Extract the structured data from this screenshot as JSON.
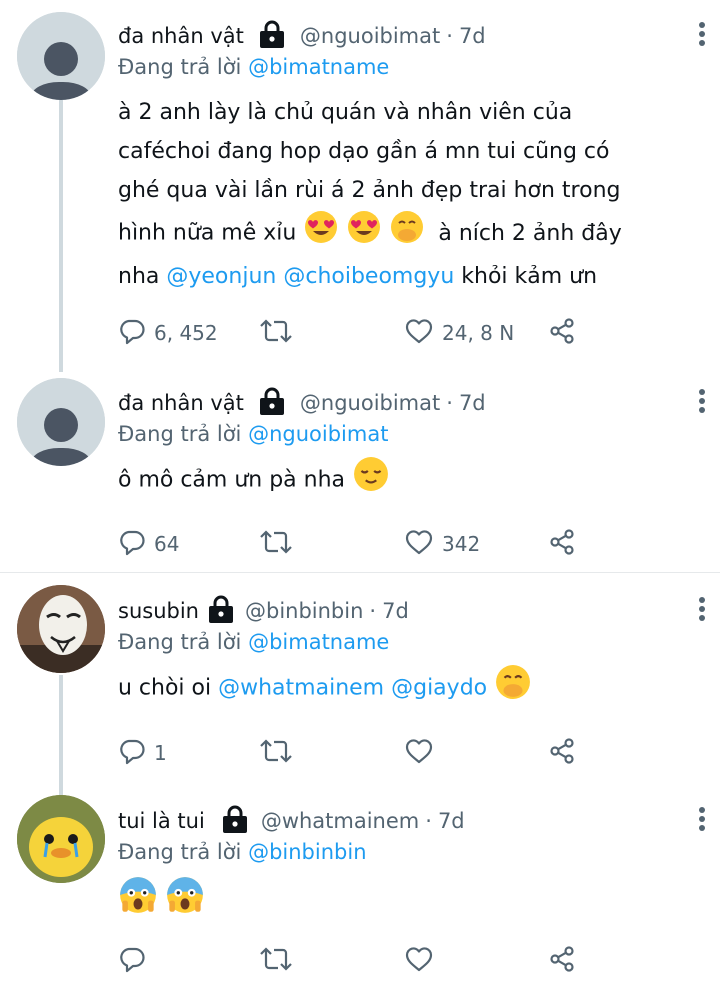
{
  "tweets": [
    {
      "name": "đa nhân vật",
      "handle": "@nguoibimat",
      "time": "7d",
      "reply_prefix": "Đang trả lời",
      "reply_to": "@bimatname",
      "text_lines": [
        "à 2 anh lày là chủ quán và nhân viên của",
        "caféchoi đang hop dạo gần á mn tui cũng có",
        "ghé qua vài lần rùi á 2 ảnh đẹp trai hơn trong"
      ],
      "line4_a": "hình nữa mê xỉu",
      "line4_b": "à ních 2 ảnh đây",
      "line5_a": "nha",
      "mention1": "@yeonjun",
      "mention2": "@choibeomgyu",
      "line5_b": "khỏi kảm ưn",
      "replies": "6, 452",
      "likes": "24, 8 N"
    },
    {
      "name": "đa nhân vật",
      "handle": "@nguoibimat",
      "time": "7d",
      "reply_prefix": "Đang trả lời",
      "reply_to": "@nguoibimat",
      "text": "ô mô cảm ưn pà nha",
      "replies": "64",
      "likes": "342"
    },
    {
      "name": "susubin",
      "handle": "@binbinbin",
      "time": "7d",
      "reply_prefix": "Đang trả lời",
      "reply_to": "@bimatname",
      "text": "u chòi oi",
      "mention1": "@whatmainem",
      "mention2": "@giaydo",
      "replies": "1",
      "likes": ""
    },
    {
      "name": "tui là tui",
      "handle": "@whatmainem",
      "time": "7d",
      "reply_prefix": "Đang trả lời",
      "reply_to": "@binbinbin",
      "replies": "",
      "likes": ""
    }
  ],
  "icons": {
    "reply": "reply-icon",
    "retweet": "retweet-icon",
    "like": "heart-icon",
    "share": "share-icon",
    "more": "more-vertical-icon",
    "lock": "lock-icon"
  },
  "colors": {
    "text": "#0f1419",
    "secondary": "#536471",
    "mention": "#1d9bf0",
    "thread_line": "#cfd9de"
  }
}
